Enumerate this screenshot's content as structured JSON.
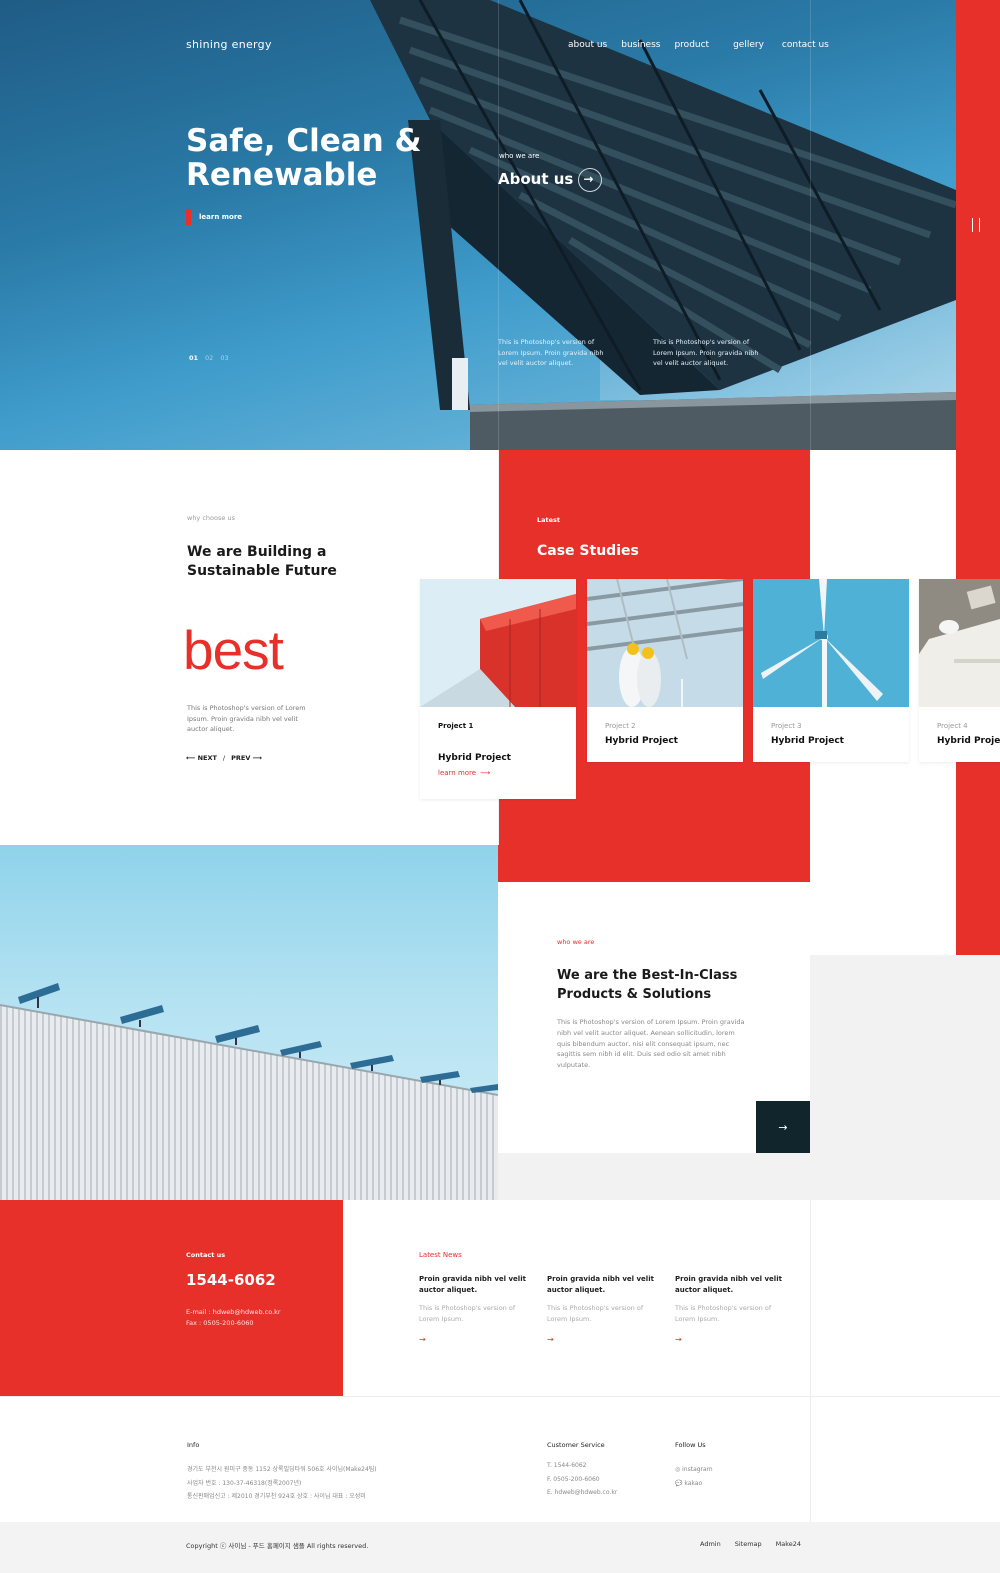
{
  "brand": {
    "logo": "shining energy",
    "accent": "#e8302b",
    "dark": "#11262c"
  },
  "nav": {
    "items": [
      "about us",
      "business",
      "product",
      "gellery",
      "contact us"
    ]
  },
  "hero": {
    "title": "Safe, Clean & Renewable",
    "learn_more": "learn more",
    "who_label": "who we are",
    "about_link": "About us",
    "about_arrow": "→",
    "note_1": "This is Photoshop's version of Lorem Ipsum. Proin gravida nibh vel velit auctor aliquet.",
    "note_2": "This is Photoshop's version of Lorem Ipsum. Proin gravida nibh vel velit auctor aliquet.",
    "pages": [
      "01",
      "02",
      "03"
    ]
  },
  "why": {
    "label": "why choose us",
    "title": "We are Building a Sustainable Future",
    "big_word": "best",
    "desc": "This is Photoshop's version of Lorem Ipsum. Proin gravida nibh vel velit auctor aliquet.",
    "next": "⟵ NEXT",
    "sep": "/",
    "prev": "PREV ⟶"
  },
  "cases": {
    "label": "Latest",
    "title": "Case Studies",
    "items": [
      {
        "project": "Project 1",
        "name": "Hybrid Project",
        "more": "learn more",
        "more_arrow": "⟶"
      },
      {
        "project": "Project 2",
        "name": "Hybrid Project"
      },
      {
        "project": "Project 3",
        "name": "Hybrid Project"
      },
      {
        "project": "Project 4",
        "name": "Hybrid Project"
      }
    ]
  },
  "solutions": {
    "label": "who we are",
    "title": "We are the Best-In-Class Products & Solutions",
    "desc": "This is Photoshop's version of Lorem Ipsum. Proin gravida nibh vel velit auctor aliquet. Aenean sollicitudin, lorem quis bibendum auctor, nisi elit consequat ipsum, nec sagittis sem nibh id elit. Duis sed odio sit amet nibh vulputate.",
    "arrow": "→"
  },
  "contact": {
    "label": "Contact us",
    "phone": "1544-6062",
    "email": "E-mail : hdweb@hdweb.co.kr",
    "fax": "Fax : 0505-200-6060"
  },
  "news": {
    "label": "Latest News",
    "items": [
      {
        "title": "Proin gravida nibh vel velit auctor aliquet.",
        "desc": "This is Photoshop's version of Lorem Ipsum.",
        "arrow": "→"
      },
      {
        "title": "Proin gravida nibh vel velit auctor aliquet.",
        "desc": "This is Photoshop's version of Lorem Ipsum.",
        "arrow": "→"
      },
      {
        "title": "Proin gravida nibh vel velit auctor aliquet.",
        "desc": "This is Photoshop's version of Lorem Ipsum.",
        "arrow": "→"
      }
    ]
  },
  "footer": {
    "info_label": "Info",
    "info_lines": [
      "경기도 부천시 원미구 중동 1152 상록빌딩타워 506호 사이님(Make24팀)",
      "사업자 번호 : 130-37-46318(정록2007년)",
      "통신판매업신고 : 제2010 경기부천 924호 상호 : 사이님 대표 : 오성미"
    ],
    "cs_label": "Customer Service",
    "cs_lines": [
      "T. 1544-6062",
      "F. 0505-200-6060",
      "E. hdweb@hdweb.co.kr"
    ],
    "follow_label": "Follow Us",
    "follow_lines": [
      "◎ instagram",
      "💬 kakao"
    ],
    "copyright": "Copyright ⓒ 사이님 - 푸드 홈페이지 샘플 All rights reserved.",
    "links": [
      "Admin",
      "Sitemap",
      "Make24"
    ]
  }
}
